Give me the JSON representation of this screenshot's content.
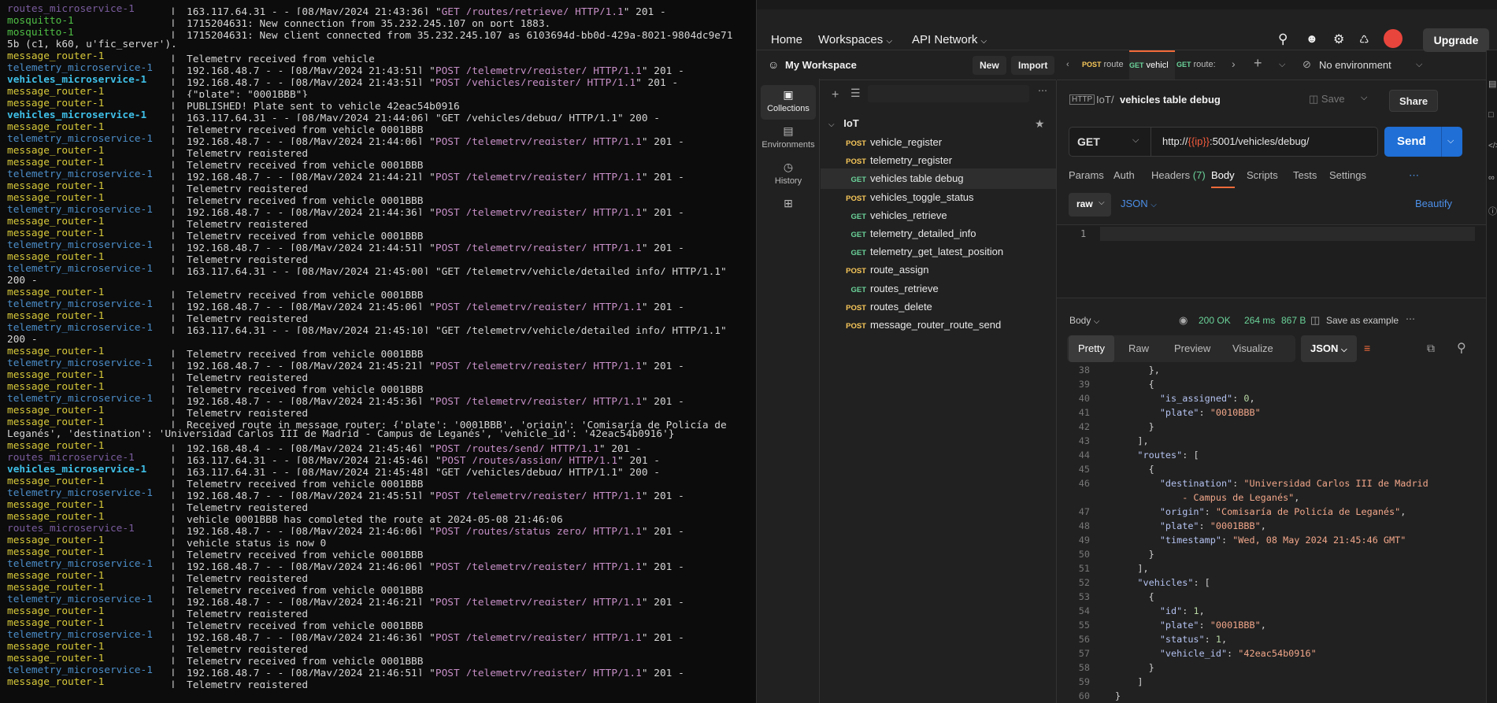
{
  "terminal": {
    "lines": [
      {
        "svc": "routes_microservice-1",
        "cls": "c-routes",
        "pre": "163.117.64.31 - - [08/May/2024 21:43:36] \"",
        "req": "GET /routes/retrieve/ HTTP/1.1",
        "post": "\" 201 -"
      },
      {
        "svc": "mosquitto-1",
        "cls": "c-mosq",
        "pre": "1715204631: New connection from 35.232.245.107 on port 1883."
      },
      {
        "svc": "mosquitto-1",
        "cls": "c-mosq",
        "pre": "1715204631: New client connected from 35.232.245.107 as 6103694d-bb0d-429a-8021-9804dc9e71"
      },
      {
        "raw": "5b (c1, k60, u'fic_server')."
      },
      {
        "svc": "message_router-1",
        "cls": "c-msg",
        "pre": "Telemetry received from vehicle"
      },
      {
        "svc": "telemetry_microservice-1",
        "cls": "c-tele",
        "pre": "192.168.48.7 - - [08/May/2024 21:43:51] \"",
        "req": "POST /telemetry/register/ HTTP/1.1",
        "post": "\" 201 -"
      },
      {
        "svc": "vehicles_microservice-1",
        "cls": "c-veh",
        "pre": "192.168.48.7 - - [08/May/2024 21:43:51] \"",
        "req": "POST /vehicles/register/ HTTP/1.1",
        "post": "\" 201 -"
      },
      {
        "svc": "message_router-1",
        "cls": "c-msg",
        "pre": "{\"plate\": \"0001BBB\"}"
      },
      {
        "svc": "message_router-1",
        "cls": "c-msg",
        "pre": "PUBLISHED! Plate sent to vehicle 42eac54b0916"
      },
      {
        "svc": "vehicles_microservice-1",
        "cls": "c-veh",
        "pre": "163.117.64.31 - - [08/May/2024 21:44:06] \"GET /vehicles/debug/ HTTP/1.1\" 200 -"
      },
      {
        "svc": "message_router-1",
        "cls": "c-msg",
        "pre": "Telemetry received from vehicle 0001BBB"
      },
      {
        "svc": "telemetry_microservice-1",
        "cls": "c-tele",
        "pre": "192.168.48.7 - - [08/May/2024 21:44:06] \"",
        "req": "POST /telemetry/register/ HTTP/1.1",
        "post": "\" 201 -"
      },
      {
        "svc": "message_router-1",
        "cls": "c-msg",
        "pre": "Telemetry registered"
      },
      {
        "svc": "message_router-1",
        "cls": "c-msg",
        "pre": "Telemetry received from vehicle 0001BBB"
      },
      {
        "svc": "telemetry_microservice-1",
        "cls": "c-tele",
        "pre": "192.168.48.7 - - [08/May/2024 21:44:21] \"",
        "req": "POST /telemetry/register/ HTTP/1.1",
        "post": "\" 201 -"
      },
      {
        "svc": "message_router-1",
        "cls": "c-msg",
        "pre": "Telemetry registered"
      },
      {
        "svc": "message_router-1",
        "cls": "c-msg",
        "pre": "Telemetry received from vehicle 0001BBB"
      },
      {
        "svc": "telemetry_microservice-1",
        "cls": "c-tele",
        "pre": "192.168.48.7 - - [08/May/2024 21:44:36] \"",
        "req": "POST /telemetry/register/ HTTP/1.1",
        "post": "\" 201 -"
      },
      {
        "svc": "message_router-1",
        "cls": "c-msg",
        "pre": "Telemetry registered"
      },
      {
        "svc": "message_router-1",
        "cls": "c-msg",
        "pre": "Telemetry received from vehicle 0001BBB"
      },
      {
        "svc": "telemetry_microservice-1",
        "cls": "c-tele",
        "pre": "192.168.48.7 - - [08/May/2024 21:44:51] \"",
        "req": "POST /telemetry/register/ HTTP/1.1",
        "post": "\" 201 -"
      },
      {
        "svc": "message_router-1",
        "cls": "c-msg",
        "pre": "Telemetry registered"
      },
      {
        "svc": "telemetry_microservice-1",
        "cls": "c-tele",
        "pre": "163.117.64.31 - - [08/May/2024 21:45:00] \"GET /telemetry/vehicle/detailed_info/ HTTP/1.1\""
      },
      {
        "raw": "200 -"
      },
      {
        "svc": "message_router-1",
        "cls": "c-msg",
        "pre": "Telemetry received from vehicle 0001BBB"
      },
      {
        "svc": "telemetry_microservice-1",
        "cls": "c-tele",
        "pre": "192.168.48.7 - - [08/May/2024 21:45:06] \"",
        "req": "POST /telemetry/register/ HTTP/1.1",
        "post": "\" 201 -"
      },
      {
        "svc": "message_router-1",
        "cls": "c-msg",
        "pre": "Telemetry registered"
      },
      {
        "svc": "telemetry_microservice-1",
        "cls": "c-tele",
        "pre": "163.117.64.31 - - [08/May/2024 21:45:10] \"GET /telemetry/vehicle/detailed_info/ HTTP/1.1\""
      },
      {
        "raw": "200 -"
      },
      {
        "svc": "message_router-1",
        "cls": "c-msg",
        "pre": "Telemetry received from vehicle 0001BBB"
      },
      {
        "svc": "telemetry_microservice-1",
        "cls": "c-tele",
        "pre": "192.168.48.7 - - [08/May/2024 21:45:21] \"",
        "req": "POST /telemetry/register/ HTTP/1.1",
        "post": "\" 201 -"
      },
      {
        "svc": "message_router-1",
        "cls": "c-msg",
        "pre": "Telemetry registered"
      },
      {
        "svc": "message_router-1",
        "cls": "c-msg",
        "pre": "Telemetry received from vehicle 0001BBB"
      },
      {
        "svc": "telemetry_microservice-1",
        "cls": "c-tele",
        "pre": "192.168.48.7 - - [08/May/2024 21:45:36] \"",
        "req": "POST /telemetry/register/ HTTP/1.1",
        "post": "\" 201 -"
      },
      {
        "svc": "message_router-1",
        "cls": "c-msg",
        "pre": "Telemetry registered"
      },
      {
        "svc": "message_router-1",
        "cls": "c-msg",
        "pre": "Received route in message router: {'plate': '0001BBB', 'origin': 'Comisaría de Policía de"
      },
      {
        "raw": "Leganés', 'destination': 'Universidad Carlos III de Madrid - Campus de Leganés', 'vehicle_id': '42eac54b0916'}"
      },
      {
        "svc": "message_router-1",
        "cls": "c-msg",
        "pre": "192.168.48.4 - - [08/May/2024 21:45:46] \"",
        "req": "POST /routes/send/ HTTP/1.1",
        "post": "\" 201 -"
      },
      {
        "svc": "routes_microservice-1",
        "cls": "c-routes",
        "pre": "163.117.64.31 - - [08/May/2024 21:45:46] \"",
        "req": "POST /routes/assign/ HTTP/1.1",
        "post": "\" 201 -"
      },
      {
        "svc": "vehicles_microservice-1",
        "cls": "c-veh",
        "pre": "163.117.64.31 - - [08/May/2024 21:45:48] \"GET /vehicles/debug/ HTTP/1.1\" 200 -"
      },
      {
        "svc": "message_router-1",
        "cls": "c-msg",
        "pre": "Telemetry received from vehicle 0001BBB"
      },
      {
        "svc": "telemetry_microservice-1",
        "cls": "c-tele",
        "pre": "192.168.48.7 - - [08/May/2024 21:45:51] \"",
        "req": "POST /telemetry/register/ HTTP/1.1",
        "post": "\" 201 -"
      },
      {
        "svc": "message_router-1",
        "cls": "c-msg",
        "pre": "Telemetry registered"
      },
      {
        "svc": "message_router-1",
        "cls": "c-msg",
        "pre": "vehicle 0001BBB has completed the route at 2024-05-08 21:46:06"
      },
      {
        "svc": "routes_microservice-1",
        "cls": "c-routes",
        "pre": "192.168.48.7 - - [08/May/2024 21:46:06] \"",
        "req": "POST /routes/status_zero/ HTTP/1.1",
        "post": "\" 201 -"
      },
      {
        "svc": "message_router-1",
        "cls": "c-msg",
        "pre": "vehicle status is now 0"
      },
      {
        "svc": "message_router-1",
        "cls": "c-msg",
        "pre": "Telemetry received from vehicle 0001BBB"
      },
      {
        "svc": "telemetry_microservice-1",
        "cls": "c-tele",
        "pre": "192.168.48.7 - - [08/May/2024 21:46:06] \"",
        "req": "POST /telemetry/register/ HTTP/1.1",
        "post": "\" 201 -"
      },
      {
        "svc": "message_router-1",
        "cls": "c-msg",
        "pre": "Telemetry registered"
      },
      {
        "svc": "message_router-1",
        "cls": "c-msg",
        "pre": "Telemetry received from vehicle 0001BBB"
      },
      {
        "svc": "telemetry_microservice-1",
        "cls": "c-tele",
        "pre": "192.168.48.7 - - [08/May/2024 21:46:21] \"",
        "req": "POST /telemetry/register/ HTTP/1.1",
        "post": "\" 201 -"
      },
      {
        "svc": "message_router-1",
        "cls": "c-msg",
        "pre": "Telemetry registered"
      },
      {
        "svc": "message_router-1",
        "cls": "c-msg",
        "pre": "Telemetry received from vehicle 0001BBB"
      },
      {
        "svc": "telemetry_microservice-1",
        "cls": "c-tele",
        "pre": "192.168.48.7 - - [08/May/2024 21:46:36] \"",
        "req": "POST /telemetry/register/ HTTP/1.1",
        "post": "\" 201 -"
      },
      {
        "svc": "message_router-1",
        "cls": "c-msg",
        "pre": "Telemetry registered"
      },
      {
        "svc": "message_router-1",
        "cls": "c-msg",
        "pre": "Telemetry received from vehicle 0001BBB"
      },
      {
        "svc": "telemetry_microservice-1",
        "cls": "c-tele",
        "pre": "192.168.48.7 - - [08/May/2024 21:46:51] \"",
        "req": "POST /telemetry/register/ HTTP/1.1",
        "post": "\" 201 -"
      },
      {
        "svc": "message_router-1",
        "cls": "c-msg",
        "pre": "Telemetry registered"
      }
    ]
  },
  "postman": {
    "nav": {
      "home": "Home",
      "workspaces": "Workspaces",
      "api_network": "API Network",
      "upgrade": "Upgrade"
    },
    "workspace": {
      "name": "My Workspace",
      "new": "New",
      "import": "Import"
    },
    "rail": [
      {
        "label": "Collections",
        "icon": "collections-icon"
      },
      {
        "label": "Environments",
        "icon": "environments-icon"
      },
      {
        "label": "History",
        "icon": "history-icon"
      },
      {
        "label": "",
        "icon": "apps-icon"
      }
    ],
    "collection": {
      "name": "IoT",
      "items": [
        {
          "method": "POST",
          "name": "vehicle_register"
        },
        {
          "method": "POST",
          "name": "telemetry_register"
        },
        {
          "method": "GET",
          "name": "vehicles table debug",
          "active": true
        },
        {
          "method": "POST",
          "name": "vehicles_toggle_status"
        },
        {
          "method": "GET",
          "name": "vehicles_retrieve"
        },
        {
          "method": "GET",
          "name": "telemetry_detailed_info"
        },
        {
          "method": "GET",
          "name": "telemetry_get_latest_position"
        },
        {
          "method": "POST",
          "name": "route_assign"
        },
        {
          "method": "GET",
          "name": "routes_retrieve"
        },
        {
          "method": "POST",
          "name": "routes_delete"
        },
        {
          "method": "POST",
          "name": "message_router_route_send"
        }
      ]
    },
    "tabs": [
      {
        "method": "POST",
        "name": "route"
      },
      {
        "method": "GET",
        "name": "vehicl"
      },
      {
        "method": "GET",
        "name": "route:"
      }
    ],
    "environment": "No environment",
    "request": {
      "breadcrumb_parent": "IoT",
      "title": "vehicles table debug",
      "save": "Save",
      "share": "Share",
      "method": "GET",
      "url_prefix": "http://",
      "url_var": "{{ip}}",
      "url_suffix": ":5001/vehicles/debug/",
      "send": "Send",
      "subtabs": [
        "Params",
        "Auth",
        "Headers",
        "(7)",
        "Body",
        "Scripts",
        "Tests",
        "Settings"
      ],
      "body_mode": "raw",
      "body_lang": "JSON",
      "beautify": "Beautify",
      "line1": "1"
    },
    "response": {
      "label": "Body",
      "status": "200 OK",
      "time": "264 ms",
      "size": "867 B",
      "save_example": "Save as example",
      "tabs": [
        "Pretty",
        "Raw",
        "Preview",
        "Visualize"
      ],
      "format": "JSON"
    },
    "code_lines": [
      {
        "n": "38",
        "t": [
          [
            "p",
            "      },"
          ]
        ]
      },
      {
        "n": "39",
        "t": [
          [
            "p",
            "      {"
          ]
        ]
      },
      {
        "n": "40",
        "t": [
          [
            "k",
            "        \"is_assigned\""
          ],
          [
            "p",
            ": "
          ],
          [
            "n",
            "0"
          ],
          [
            "p",
            ","
          ]
        ]
      },
      {
        "n": "41",
        "t": [
          [
            "k",
            "        \"plate\""
          ],
          [
            "p",
            ": "
          ],
          [
            "s",
            "\"0010BBB\""
          ]
        ]
      },
      {
        "n": "42",
        "t": [
          [
            "p",
            "      }"
          ]
        ]
      },
      {
        "n": "43",
        "t": [
          [
            "p",
            "    ],"
          ]
        ]
      },
      {
        "n": "44",
        "t": [
          [
            "k",
            "    \"routes\""
          ],
          [
            "p",
            ": ["
          ]
        ]
      },
      {
        "n": "45",
        "t": [
          [
            "p",
            "      {"
          ]
        ]
      },
      {
        "n": "46",
        "t": [
          [
            "k",
            "        \"destination\""
          ],
          [
            "p",
            ": "
          ],
          [
            "s",
            "\"Universidad Carlos III de Madrid"
          ]
        ]
      },
      {
        "n": "",
        "t": [
          [
            "s",
            "            - Campus de Leganés\""
          ],
          [
            "p",
            ","
          ]
        ]
      },
      {
        "n": "47",
        "t": [
          [
            "k",
            "        \"origin\""
          ],
          [
            "p",
            ": "
          ],
          [
            "s",
            "\"Comisaría de Policía de Leganés\""
          ],
          [
            "p",
            ","
          ]
        ]
      },
      {
        "n": "48",
        "t": [
          [
            "k",
            "        \"plate\""
          ],
          [
            "p",
            ": "
          ],
          [
            "s",
            "\"0001BBB\""
          ],
          [
            "p",
            ","
          ]
        ]
      },
      {
        "n": "49",
        "t": [
          [
            "k",
            "        \"timestamp\""
          ],
          [
            "p",
            ": "
          ],
          [
            "s",
            "\"Wed, 08 May 2024 21:45:46 GMT\""
          ]
        ]
      },
      {
        "n": "50",
        "t": [
          [
            "p",
            "      }"
          ]
        ]
      },
      {
        "n": "51",
        "t": [
          [
            "p",
            "    ],"
          ]
        ]
      },
      {
        "n": "52",
        "t": [
          [
            "k",
            "    \"vehicles\""
          ],
          [
            "p",
            ": ["
          ]
        ]
      },
      {
        "n": "53",
        "t": [
          [
            "p",
            "      {"
          ]
        ]
      },
      {
        "n": "54",
        "t": [
          [
            "k",
            "        \"id\""
          ],
          [
            "p",
            ": "
          ],
          [
            "n",
            "1"
          ],
          [
            "p",
            ","
          ]
        ]
      },
      {
        "n": "55",
        "t": [
          [
            "k",
            "        \"plate\""
          ],
          [
            "p",
            ": "
          ],
          [
            "s",
            "\"0001BBB\""
          ],
          [
            "p",
            ","
          ]
        ]
      },
      {
        "n": "56",
        "t": [
          [
            "k",
            "        \"status\""
          ],
          [
            "p",
            ": "
          ],
          [
            "n",
            "1"
          ],
          [
            "p",
            ","
          ]
        ]
      },
      {
        "n": "57",
        "t": [
          [
            "k",
            "        \"vehicle_id\""
          ],
          [
            "p",
            ": "
          ],
          [
            "s",
            "\"42eac54b0916\""
          ]
        ]
      },
      {
        "n": "58",
        "t": [
          [
            "p",
            "      }"
          ]
        ]
      },
      {
        "n": "59",
        "t": [
          [
            "p",
            "    ]"
          ]
        ]
      },
      {
        "n": "60",
        "t": [
          [
            "p",
            "}"
          ]
        ]
      }
    ]
  }
}
